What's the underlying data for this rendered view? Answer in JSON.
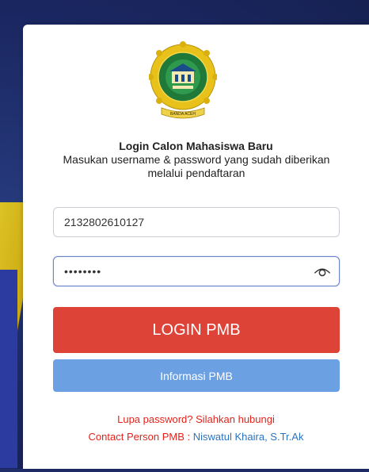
{
  "login": {
    "title": "Login Calon Mahasiswa Baru",
    "subtitle": "Masukan username & password yang sudah diberikan melalui pendaftaran"
  },
  "username": {
    "value": "2132802610127"
  },
  "password": {
    "masked_value": "••••••••"
  },
  "buttons": {
    "login_label": "LOGIN PMB",
    "info_label": "Informasi PMB"
  },
  "help": {
    "forgot_text": "Lupa password? Silahkan hubungi",
    "contact_prefix": "Contact Person PMB : ",
    "contact_name": "Niswatul Khaira, S.Tr.Ak"
  },
  "logo": {
    "caption": "BANDA ACEH"
  },
  "icons": {
    "password_toggle": "eye-icon",
    "logo": "institution-emblem"
  },
  "colors": {
    "login_button": "#de4338",
    "info_button": "#6ba1e3",
    "help_text": "#e5221b",
    "link": "#2b73c0"
  }
}
